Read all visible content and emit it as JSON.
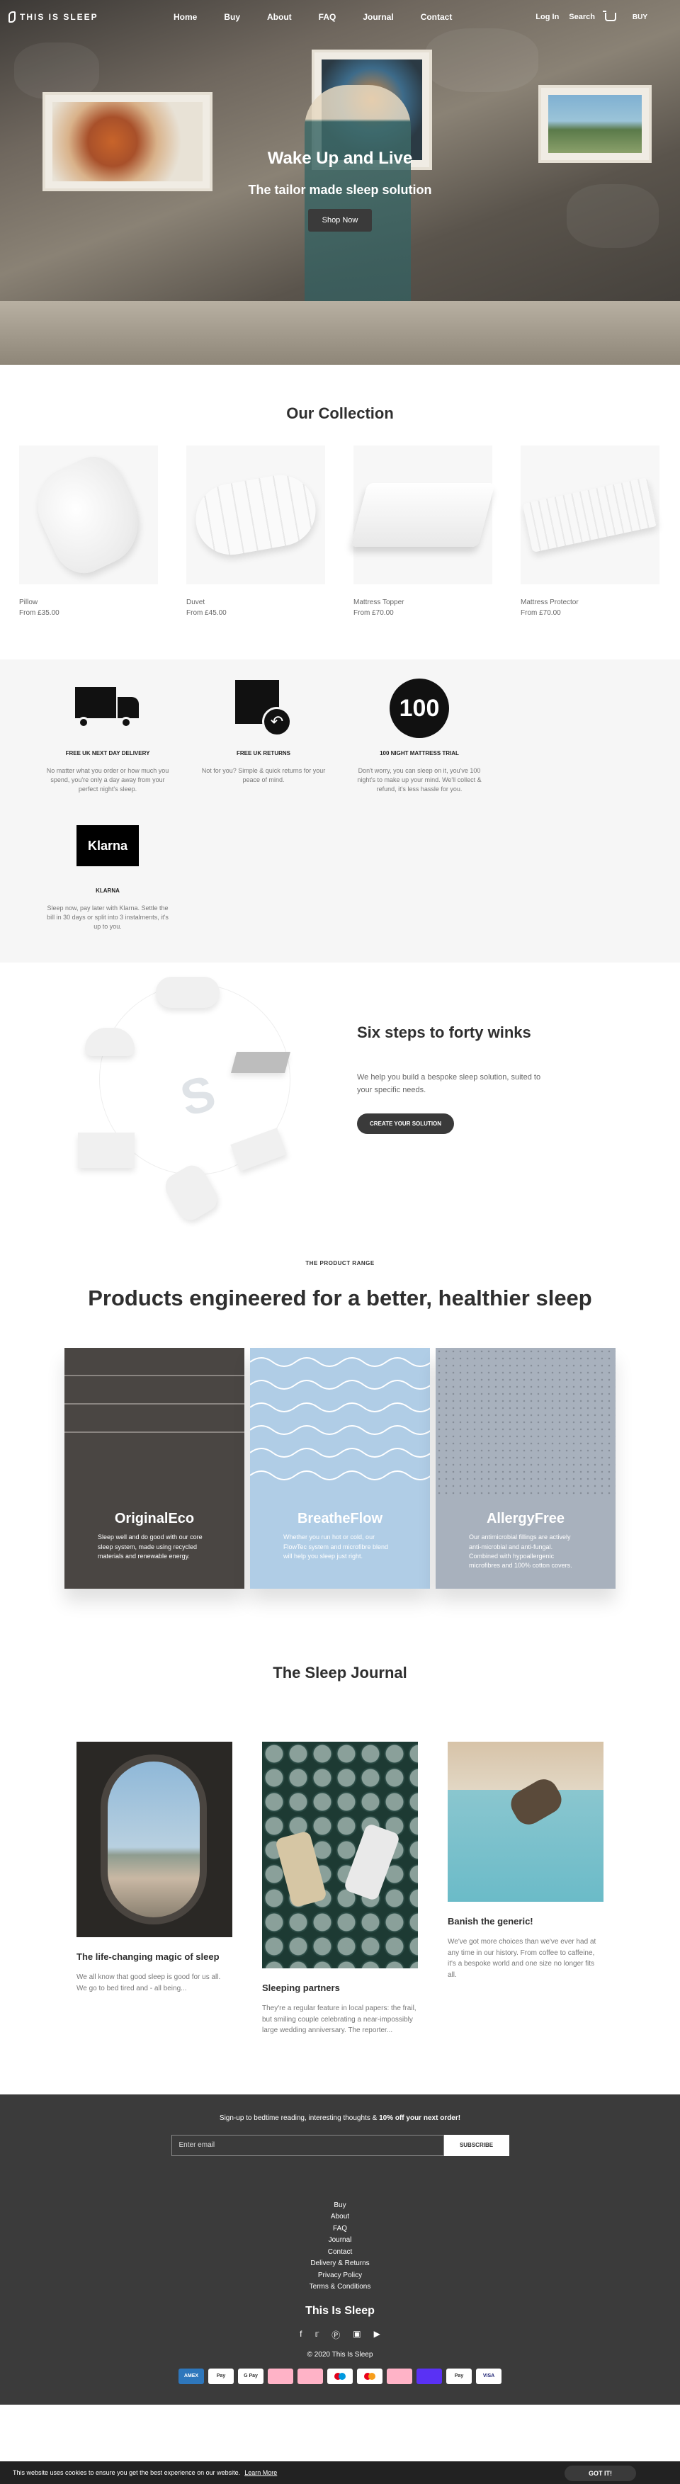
{
  "header": {
    "brand": "THIS IS SLEEP",
    "nav": [
      "Home",
      "Buy",
      "About",
      "FAQ",
      "Journal",
      "Contact"
    ],
    "login": "Log In",
    "search": "Search",
    "buy": "BUY"
  },
  "hero": {
    "title": "Wake Up and Live",
    "subtitle": "The tailor made sleep solution",
    "button": "Shop Now"
  },
  "collection": {
    "title": "Our Collection",
    "products": [
      {
        "name": "Pillow",
        "price": "From £35.00"
      },
      {
        "name": "Duvet",
        "price": "From £45.00"
      },
      {
        "name": "Mattress Topper",
        "price": "From £70.00"
      },
      {
        "name": "Mattress Protector",
        "price": "From £70.00"
      }
    ]
  },
  "features": [
    {
      "icon": "truck-icon",
      "title": "FREE UK NEXT DAY DELIVERY",
      "text": "No matter what you order or how much you spend, you're only a day away from your perfect night's sleep."
    },
    {
      "icon": "returns-icon",
      "title": "FREE UK RETURNS",
      "text": "Not for you? Simple & quick returns for your peace of mind."
    },
    {
      "icon": "hundred-icon",
      "icon_text": "100",
      "title": "100 NIGHT MATTRESS TRIAL",
      "text": "Don't worry, you can sleep on it, you've 100 night's to make up your mind. We'll collect & refund, it's less hassle for you."
    },
    {
      "icon": "klarna-icon",
      "icon_text": "Klarna",
      "title": "KLARNA",
      "text": "Sleep now, pay later with Klarna. Settle the bill in 30 days or split into 3 instalments, it's up to you."
    }
  ],
  "steps": {
    "title": "Six steps to forty winks",
    "description": "We help you build a bespoke sleep solution, suited to your specific needs.",
    "button": "CREATE YOUR SOLUTION"
  },
  "ranges": {
    "eyebrow": "THE PRODUCT RANGE",
    "title": "Products engineered for a better, healthier sleep",
    "cards": [
      {
        "name": "OriginalEco",
        "text": "Sleep well and do good with our core sleep system, made using recycled materials and renewable energy.",
        "color": "#4a4643"
      },
      {
        "name": "BreatheFlow",
        "text": "Whether you run hot or cold, our FlowTec system and microfibre blend will help you sleep just right.",
        "color": "#b0cde6"
      },
      {
        "name": "AllergyFree",
        "text": "Our antimicrobial fillings are actively anti-microbial and anti-fungal. Combined with hypoallergenic microfibres and 100% cotton covers.",
        "color": "#a8b1bd"
      }
    ]
  },
  "journal": {
    "title": "The Sleep Journal",
    "posts": [
      {
        "title": "The life-changing magic of sleep",
        "text": "We all know that good sleep is good for us all. We go to bed tired and - all being..."
      },
      {
        "title": "Sleeping partners",
        "text": "They're a regular feature in local papers: the frail, but smiling couple celebrating a near-impossibly large wedding anniversary. The reporter..."
      },
      {
        "title": "Banish the generic!",
        "text": "We've got more choices than we've ever had at any time in our history. From coffee to caffeine, it's a bespoke world and one size no longer fits all."
      }
    ]
  },
  "footer": {
    "signup_text": "Sign-up to bedtime reading, interesting thoughts & ",
    "signup_bold": "10% off your next order!",
    "email_placeholder": "Enter email",
    "subscribe": "SUBSCRIBE",
    "links": [
      "Buy",
      "About",
      "FAQ",
      "Journal",
      "Contact",
      "Delivery & Returns",
      "Privacy Policy",
      "Terms & Conditions"
    ],
    "brand": "This Is Sleep",
    "social": [
      "facebook-icon",
      "twitter-icon",
      "pinterest-icon",
      "instagram-icon",
      "youtube-icon"
    ],
    "copyright": "© 2020 This Is Sleep",
    "payments": [
      "AMEX",
      "Pay",
      "G Pay",
      "",
      "",
      "",
      "",
      "",
      "",
      "Pay",
      "VISA"
    ]
  },
  "cookie": {
    "text": "This website uses cookies to ensure you get the best experience on our website.",
    "link": "Learn More",
    "button": "GOT IT!"
  }
}
